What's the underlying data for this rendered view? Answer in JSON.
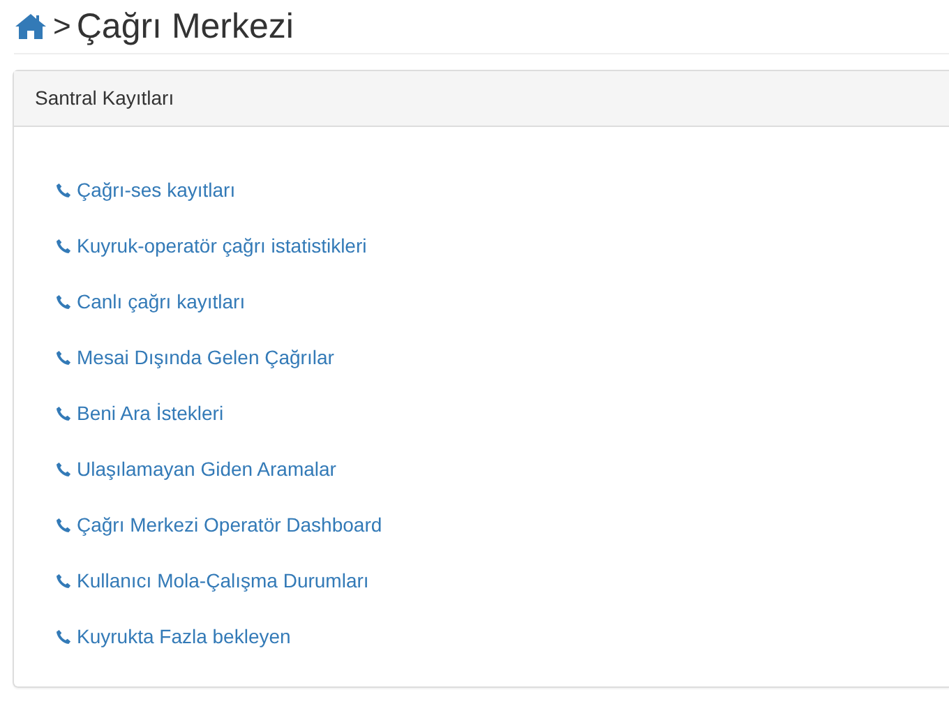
{
  "breadcrumb": {
    "separator": ">",
    "title": "Çağrı Merkezi"
  },
  "panel": {
    "title": "Santral Kayıtları",
    "links": [
      {
        "label": "Çağrı-ses kayıtları"
      },
      {
        "label": "Kuyruk-operatör çağrı istatistikleri"
      },
      {
        "label": "Canlı çağrı kayıtları"
      },
      {
        "label": "Mesai Dışında Gelen Çağrılar"
      },
      {
        "label": "Beni Ara İstekleri"
      },
      {
        "label": "Ulaşılamayan Giden Aramalar"
      },
      {
        "label": "Çağrı Merkezi Operatör Dashboard"
      },
      {
        "label": "Kullanıcı Mola-Çalışma Durumları"
      },
      {
        "label": "Kuyrukta Fazla bekleyen"
      }
    ]
  }
}
